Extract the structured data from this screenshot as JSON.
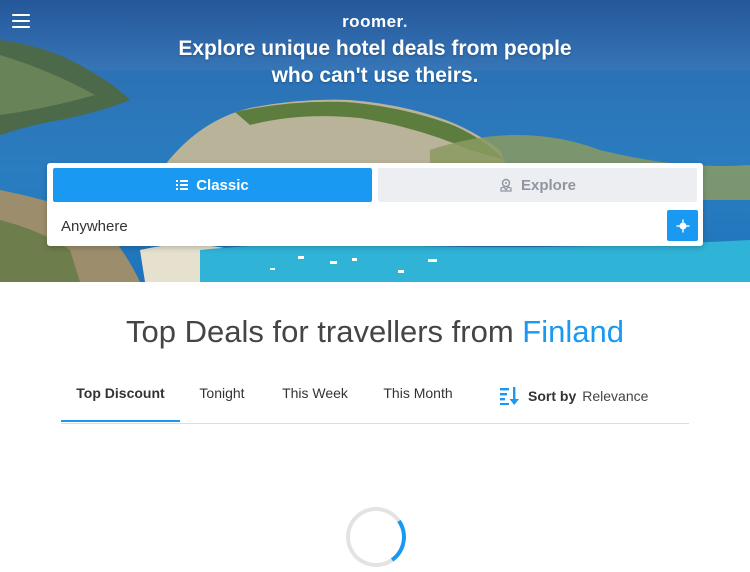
{
  "header": {
    "logo": "roomer",
    "logo_dot": ".",
    "headline": "Explore unique hotel deals from people who can't use theirs."
  },
  "search": {
    "tabs": [
      {
        "label": "Classic",
        "icon": "list-icon",
        "active": true
      },
      {
        "label": "Explore",
        "icon": "map-pin-icon",
        "active": false
      }
    ],
    "location_value": "Anywhere",
    "locate_icon": "crosshair-icon"
  },
  "deals": {
    "title_prefix": "Top Deals for travellers from ",
    "country": "Finland",
    "filters": [
      {
        "label": "Top Discount",
        "active": true
      },
      {
        "label": "Tonight",
        "active": false
      },
      {
        "label": "This Week",
        "active": false
      },
      {
        "label": "This Month",
        "active": false
      }
    ],
    "sort_label": "Sort by",
    "sort_value": "Relevance",
    "sort_icon": "sort-icon"
  },
  "colors": {
    "accent": "#1a99f2",
    "tab_inactive_bg": "#eceef1",
    "text": "#454545"
  }
}
